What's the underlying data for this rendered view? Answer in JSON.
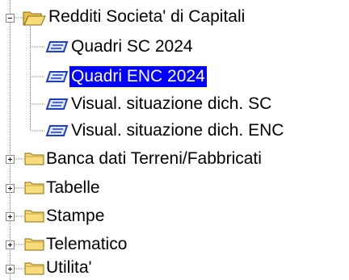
{
  "tree": {
    "root": {
      "label": "Redditi Societa' di Capitali",
      "expanded": true,
      "icon": "folder-open-icon"
    },
    "children": [
      {
        "label": "Quadri SC  2024",
        "icon": "form-icon",
        "selected": false
      },
      {
        "label": "Quadri ENC 2024",
        "icon": "form-icon",
        "selected": true
      },
      {
        "label": "Visual. situazione dich. SC",
        "icon": "form-icon",
        "selected": false
      },
      {
        "label": "Visual. situazione dich. ENC",
        "icon": "form-icon",
        "selected": false
      }
    ],
    "siblings": [
      {
        "label": "Banca dati Terreni/Fabbricati",
        "icon": "folder-icon",
        "expanded": false
      },
      {
        "label": "Tabelle",
        "icon": "folder-icon",
        "expanded": false
      },
      {
        "label": "Stampe",
        "icon": "folder-icon",
        "expanded": false
      },
      {
        "label": "Telematico",
        "icon": "folder-icon",
        "expanded": false
      },
      {
        "label": "Utilita'",
        "icon": "folder-icon",
        "expanded": false
      }
    ]
  },
  "colors": {
    "selection_bg": "#0000ff",
    "selection_text": "#ffffff",
    "folder_yellow": "#f5d76e",
    "form_blue": "#1f3fbf"
  }
}
